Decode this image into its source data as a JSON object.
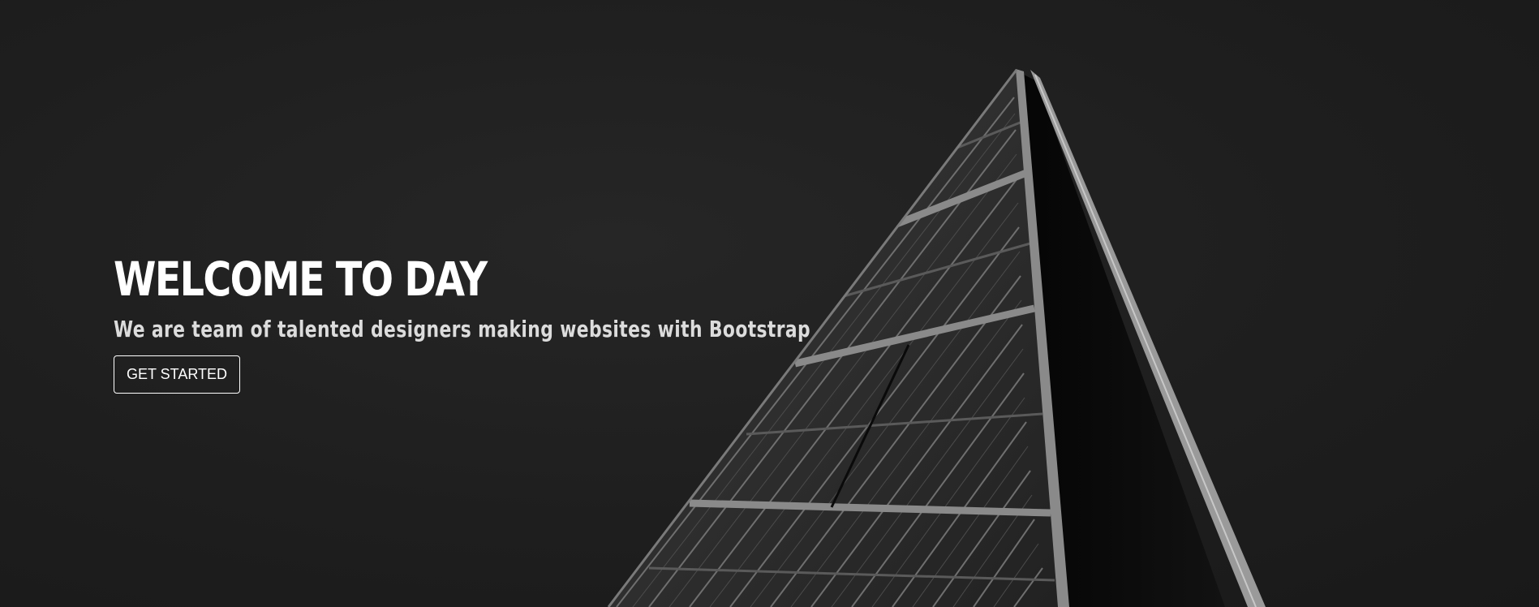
{
  "hero": {
    "title": "WELCOME TO DAY",
    "subtitle": "We are team of talented designers making websites with Bootstrap",
    "cta_label": "GET STARTED"
  },
  "background": {
    "image": "building-icon",
    "colors": {
      "sky": "#1d1d1d",
      "glass": "#2c2c2c",
      "frame": "#8a8a8a",
      "shadow_face": "#0b0b0b"
    }
  }
}
